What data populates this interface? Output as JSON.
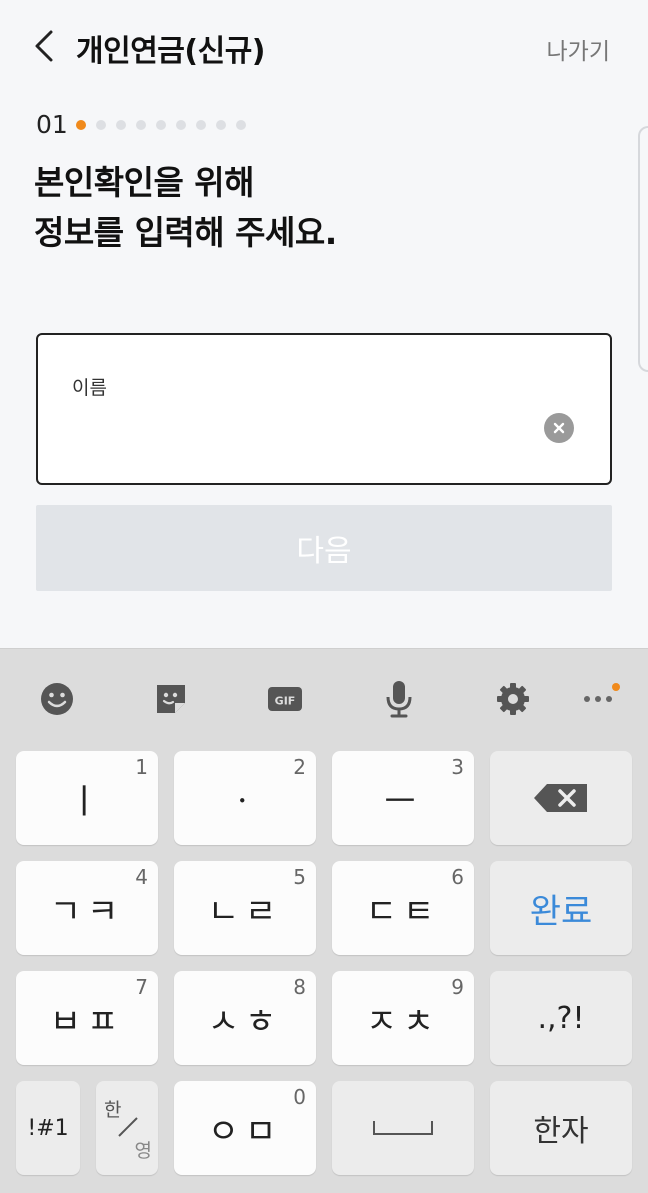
{
  "header": {
    "title": "개인연금(신규)",
    "exit_label": "나가기"
  },
  "stepper": {
    "current": "01",
    "total_steps": 9,
    "active_index": 0
  },
  "headline": {
    "line1": "본인확인을 위해",
    "line2": "정보를 입력해 주세요."
  },
  "form": {
    "name_label": "이름",
    "name_value": "",
    "next_label": "다음"
  },
  "keyboard": {
    "toolbar": [
      "emoji-icon",
      "sticker-icon",
      "gif-icon",
      "microphone-icon",
      "settings-icon",
      "more-icon"
    ],
    "gif_label": "GIF",
    "rows": [
      [
        {
          "label": "ㅣ",
          "num": "1"
        },
        {
          "label": "ㆍ",
          "num": "2"
        },
        {
          "label": "ㅡ",
          "num": "3"
        },
        {
          "label": "",
          "num": ""
        }
      ],
      [
        {
          "label": "ㄱㅋ",
          "num": "4"
        },
        {
          "label": "ㄴㄹ",
          "num": "5"
        },
        {
          "label": "ㄷㅌ",
          "num": "6"
        },
        {
          "label": "완료",
          "num": ""
        }
      ],
      [
        {
          "label": "ㅂㅍ",
          "num": "7"
        },
        {
          "label": "ㅅㅎ",
          "num": "8"
        },
        {
          "label": "ㅈㅊ",
          "num": "9"
        },
        {
          "label": ".,?!",
          "num": ""
        }
      ],
      [
        {
          "label": "!#1",
          "num": ""
        },
        {
          "label": "한",
          "num": ""
        },
        {
          "label": "ㅇㅁ",
          "num": "0"
        },
        {
          "label": "",
          "num": ""
        },
        {
          "label": "한자",
          "num": ""
        }
      ]
    ],
    "lang_sub": "영",
    "accent_color": "#f08a1c",
    "done_color": "#3b8ad9"
  }
}
